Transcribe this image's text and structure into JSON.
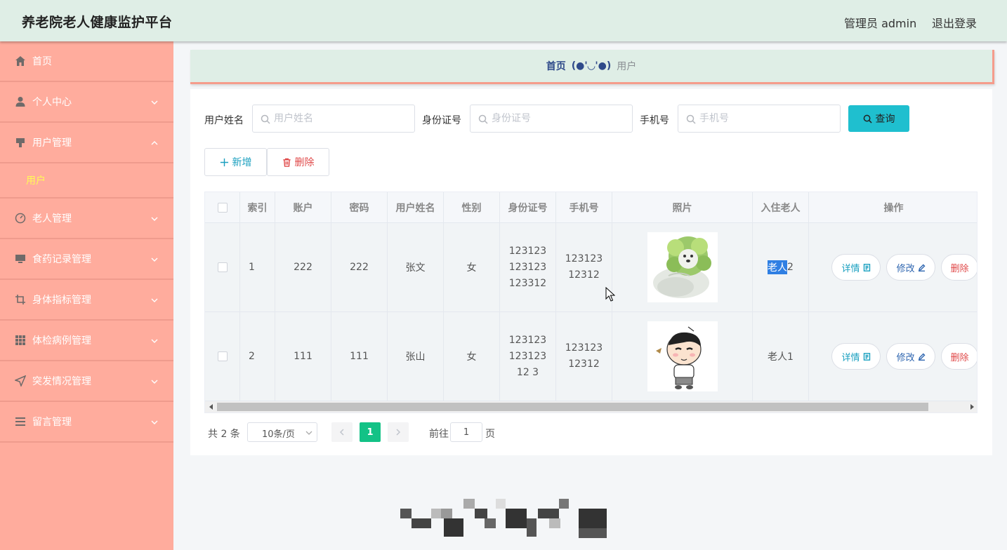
{
  "header": {
    "title": "养老院老人健康监护平台",
    "admin_label": "管理员 admin",
    "logout_label": "退出登录",
    "background": "#dfeee6"
  },
  "sidebar": {
    "background": "#ffac9d",
    "items": [
      {
        "label": "首页",
        "icon": "home-icon"
      },
      {
        "label": "个人中心",
        "icon": "user-icon"
      },
      {
        "label": "用户管理",
        "icon": "flag-icon",
        "expanded": true,
        "children": [
          {
            "label": "用户",
            "active": true
          }
        ]
      },
      {
        "label": "老人管理",
        "icon": "gauge-icon"
      },
      {
        "label": "食药记录管理",
        "icon": "monitor-icon"
      },
      {
        "label": "身体指标管理",
        "icon": "crop-icon"
      },
      {
        "label": "体检病例管理",
        "icon": "grid-icon"
      },
      {
        "label": "突发情况管理",
        "icon": "send-icon"
      },
      {
        "label": "留言管理",
        "icon": "list-icon"
      }
    ]
  },
  "breadcrumb": {
    "home": "首页",
    "separator": "(●'◡'●)",
    "current": "用户"
  },
  "search": {
    "name_label": "用户姓名",
    "name_placeholder": "用户姓名",
    "id_label": "身份证号",
    "id_placeholder": "身份证号",
    "phone_label": "手机号",
    "phone_placeholder": "手机号",
    "query_button": "查询",
    "query_color": "#1fbfcf"
  },
  "actions": {
    "add": "新增",
    "delete": "删除"
  },
  "table": {
    "columns": [
      "",
      "索引",
      "账户",
      "密码",
      "用户姓名",
      "性别",
      "身份证号",
      "手机号",
      "照片",
      "入住老人",
      "操作"
    ],
    "rows": [
      {
        "index": "1",
        "account": "222",
        "password": "222",
        "name": "张文",
        "gender": "女",
        "id_number": "123123123123123312",
        "phone": "12312312312",
        "photo": "cabbage-dog-photo",
        "elder_selected": "老人",
        "elder_rest": "2"
      },
      {
        "index": "2",
        "account": "111",
        "password": "111",
        "name": "张山",
        "gender": "女",
        "id_number": "12312312312312 3",
        "phone": "12312312312",
        "photo": "cartoon-boy-photo",
        "elder_selected": "",
        "elder_rest": "老人1"
      }
    ],
    "row_actions": {
      "detail": "详情",
      "edit": "修改",
      "delete": "删除"
    }
  },
  "pagination": {
    "total": "共 2 条",
    "page_size": "10条/页",
    "current_page": "1",
    "goto_label": "前往",
    "goto_value": "1",
    "page_unit": "页",
    "active_color": "#13c286"
  }
}
